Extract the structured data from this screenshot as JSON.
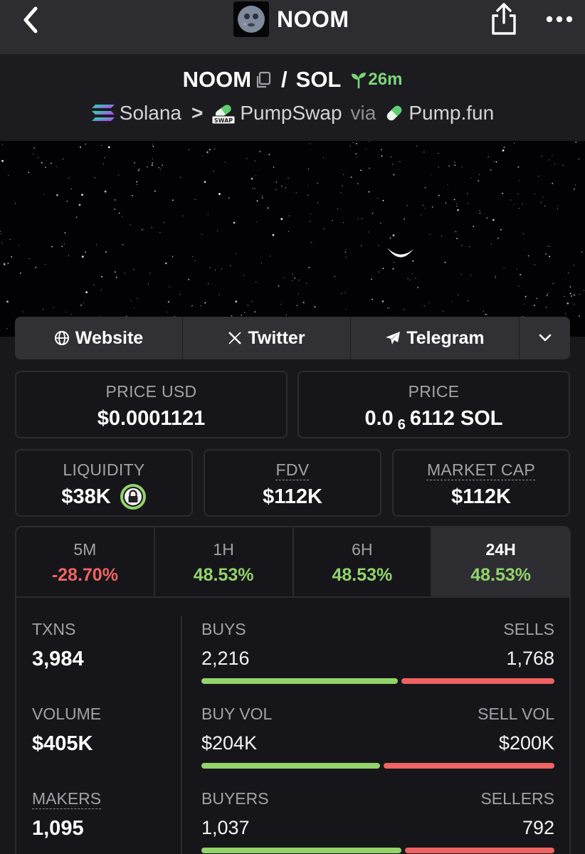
{
  "nav": {
    "title": "NOOM",
    "back_icon": "chevron-left-icon",
    "share_icon": "share-icon",
    "more_icon": "ellipsis-icon"
  },
  "pair": {
    "base": "NOOM",
    "separator": "/",
    "quote": "SOL",
    "age": "26m",
    "chain": "Solana",
    "dex": "PumpSwap",
    "via": "via",
    "launchpad": "Pump.fun",
    "dex_badge_text": "SWAP"
  },
  "links": {
    "website": "Website",
    "twitter": "Twitter",
    "telegram": "Telegram"
  },
  "stats": {
    "price_usd_label": "PRICE USD",
    "price_usd_value": "$0.0001121",
    "price_label": "PRICE",
    "price_prefix": "0.0",
    "price_zeros": "6",
    "price_digits": "6112 SOL",
    "liquidity_label": "LIQUIDITY",
    "liquidity_value": "$38K",
    "fdv_label": "FDV",
    "fdv_value": "$112K",
    "mcap_label": "MARKET CAP",
    "mcap_value": "$112K"
  },
  "timeframes": [
    {
      "label": "5M",
      "change": "-28.70%"
    },
    {
      "label": "1H",
      "change": "48.53%"
    },
    {
      "label": "6H",
      "change": "48.53%"
    },
    {
      "label": "24H",
      "change": "48.53%"
    }
  ],
  "active_timeframe": "24H",
  "txn": {
    "txns_label": "TXNS",
    "txns_value": "3,984",
    "volume_label": "VOLUME",
    "volume_value": "$405K",
    "makers_label": "MAKERS",
    "makers_value": "1,095",
    "buys_label": "BUYS",
    "buys_value": "2,216",
    "sells_label": "SELLS",
    "sells_value": "1,768",
    "buy_vol_label": "BUY VOL",
    "buy_vol_value": "$204K",
    "sell_vol_label": "SELL VOL",
    "sell_vol_value": "$200K",
    "buyers_label": "BUYERS",
    "buyers_value": "1,037",
    "sellers_label": "SELLERS",
    "sellers_value": "792"
  },
  "colors": {
    "positive": "#92d36a",
    "negative": "#ef6363",
    "age_green": "#7bd67b"
  }
}
